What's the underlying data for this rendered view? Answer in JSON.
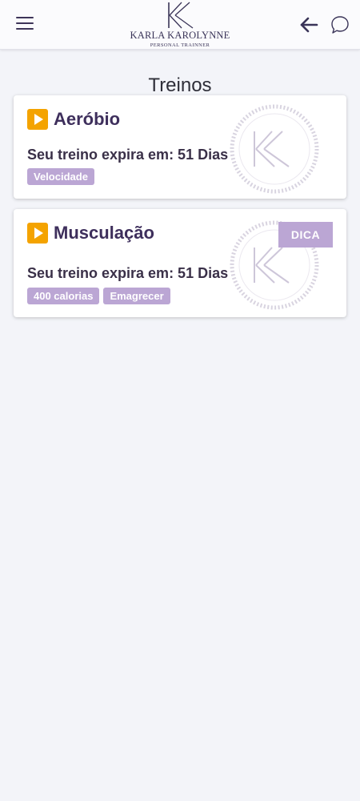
{
  "header": {
    "brand_name": "KARLA KAROLYNNE",
    "brand_subtitle": "PERSONAL TRAINNER",
    "icons": [
      "menu-icon",
      "arrow-left-icon",
      "chat-bubble-icon"
    ]
  },
  "page": {
    "title": "Treinos"
  },
  "cards": [
    {
      "title": "Aeróbio",
      "expiry": "Seu treino expira em: 51 Dias",
      "tags": [
        "Velocidade"
      ]
    },
    {
      "title": "Musculação",
      "expiry": "Seu treino expira em: 51 Dias",
      "tags": [
        "400 calorias",
        "Emagrecer"
      ],
      "badge": "DICA"
    }
  ],
  "colors": {
    "brand_purple": "#3e2f5c",
    "tag_lilac": "#bba6d4",
    "play_orange": "#f4a300",
    "background": "#f3f4f9"
  }
}
